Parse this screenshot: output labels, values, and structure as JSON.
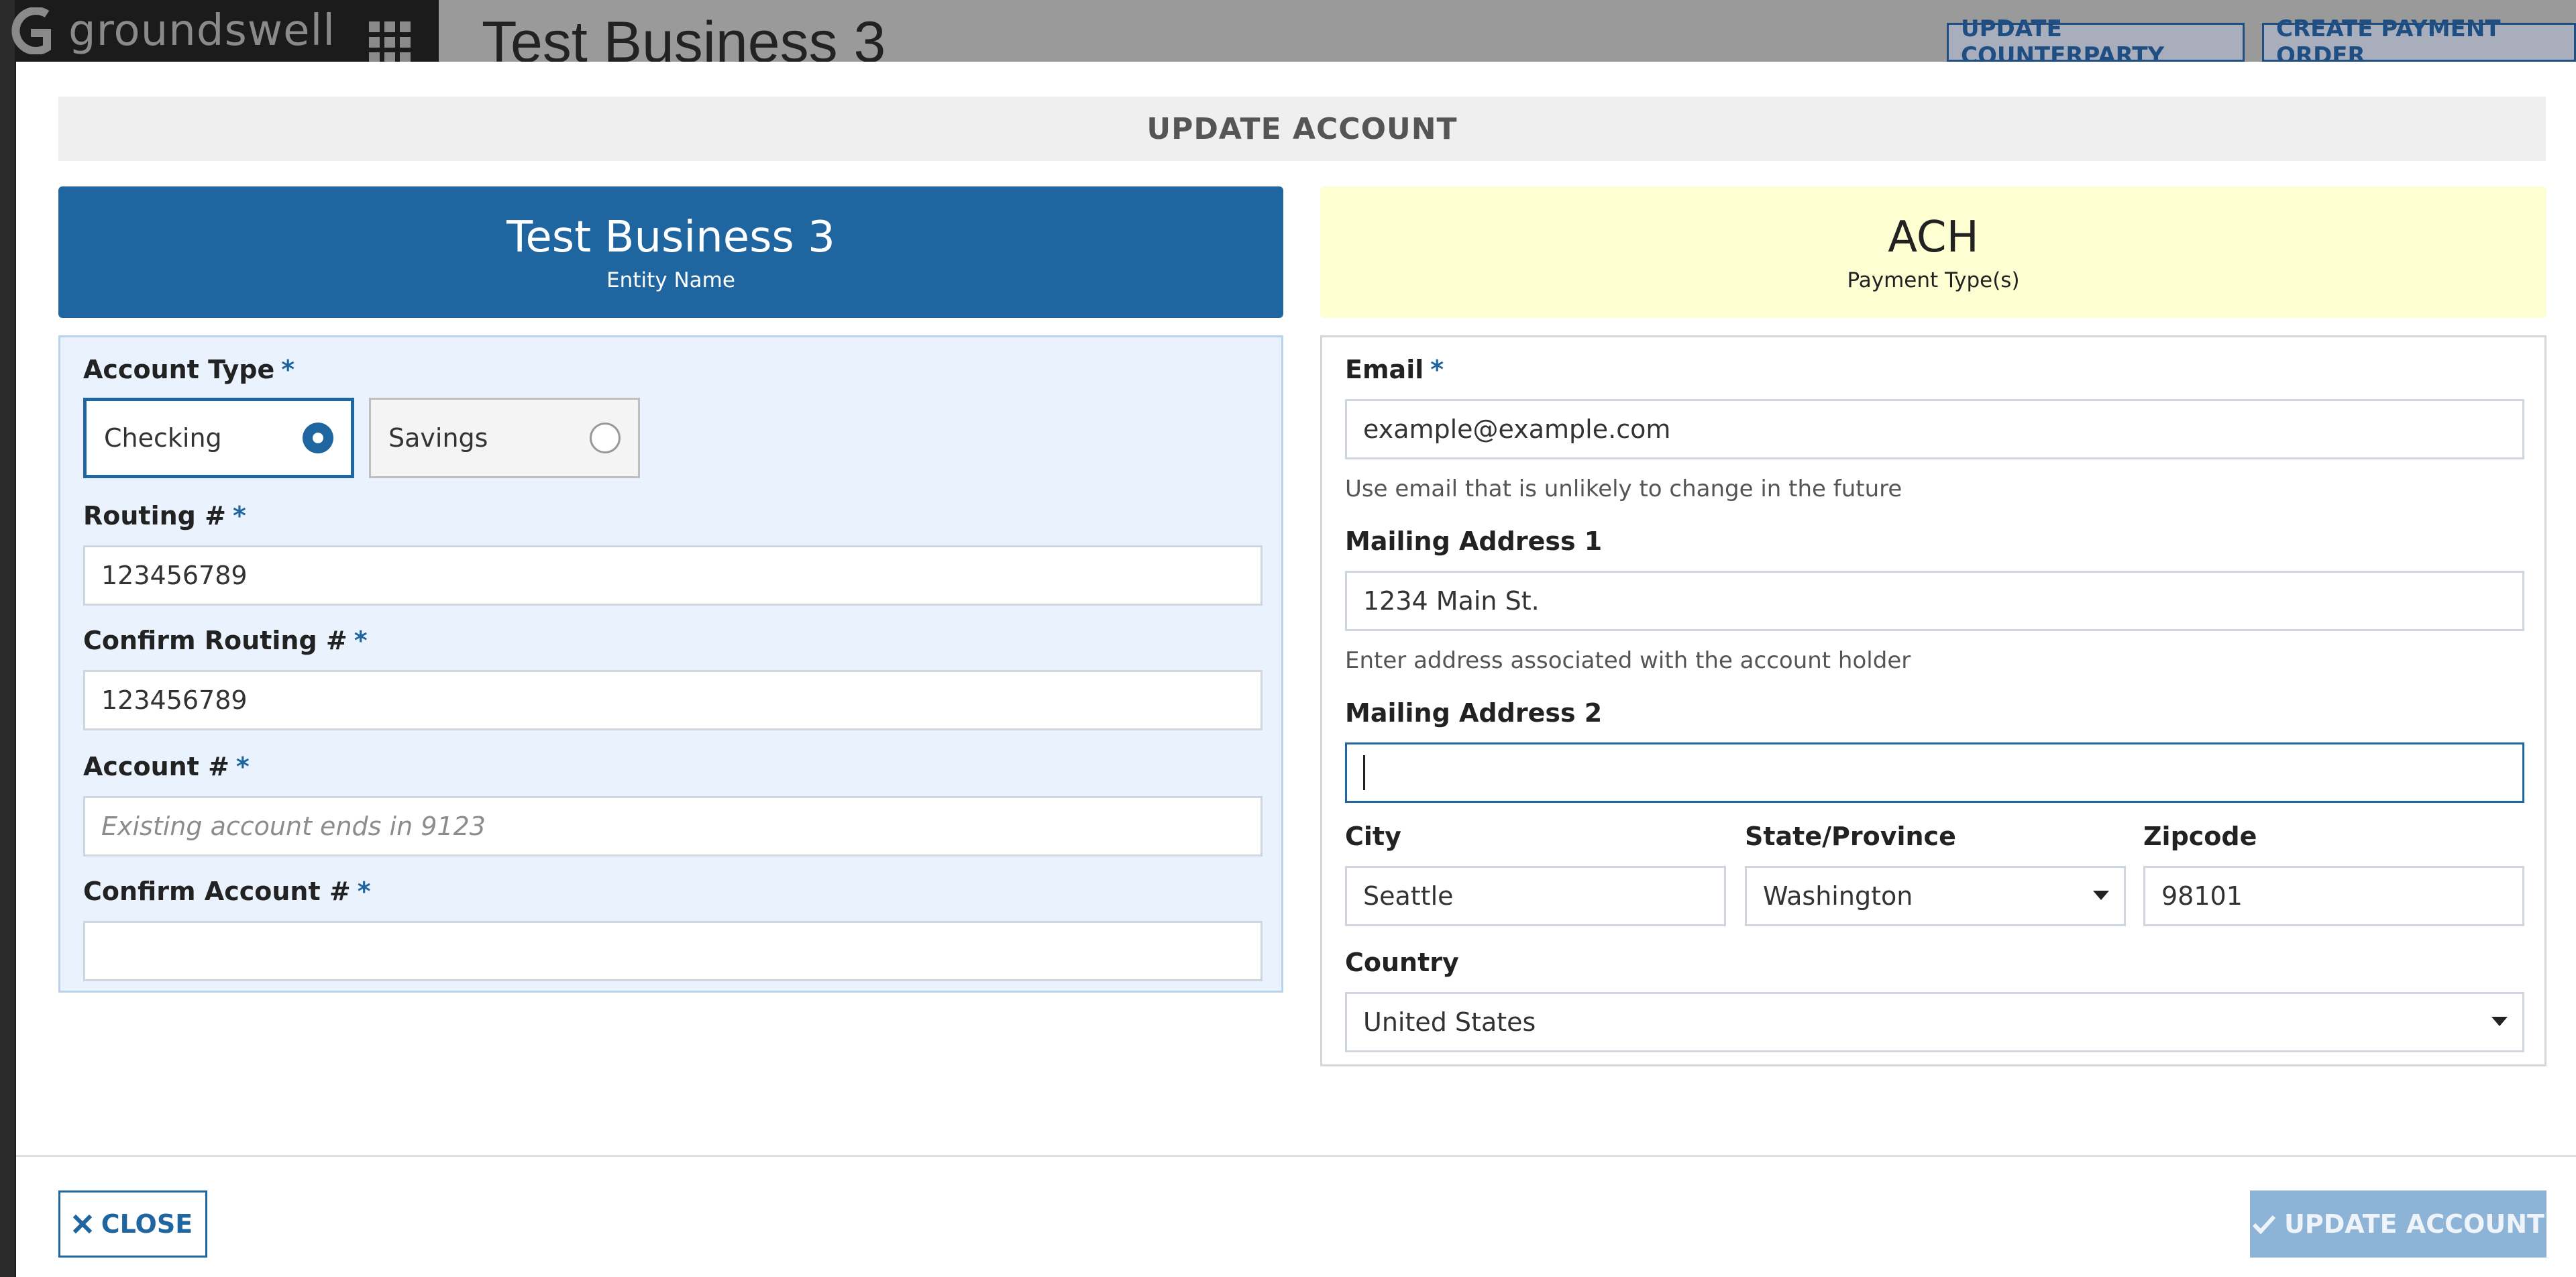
{
  "background": {
    "logo_text": "groundswell",
    "page_title": "Test Business 3",
    "buttons": [
      "UPDATE COUNTERPARTY",
      "CREATE PAYMENT ORDER"
    ]
  },
  "modal": {
    "title": "UPDATE ACCOUNT",
    "entity": {
      "name": "Test Business 3",
      "caption": "Entity Name"
    },
    "payment": {
      "type": "ACH",
      "caption": "Payment Type(s)"
    },
    "left": {
      "account_type_label": "Account Type",
      "account_type_options": [
        {
          "label": "Checking",
          "selected": true
        },
        {
          "label": "Savings",
          "selected": false
        }
      ],
      "routing_label": "Routing #",
      "routing_value": "123456789",
      "confirm_routing_label": "Confirm Routing #",
      "confirm_routing_value": "123456789",
      "account_label": "Account #",
      "account_placeholder": "Existing account ends in 9123",
      "confirm_account_label": "Confirm Account #",
      "confirm_account_value": ""
    },
    "right": {
      "email_label": "Email",
      "email_value": "example@example.com",
      "email_help": "Use email that is unlikely to change in the future",
      "address1_label": "Mailing Address 1",
      "address1_value": "1234 Main St.",
      "address1_help": "Enter address associated with the account holder",
      "address2_label": "Mailing Address 2",
      "address2_value": "",
      "city_label": "City",
      "city_value": "Seattle",
      "state_label": "State/Province",
      "state_value": "Washington",
      "zip_label": "Zipcode",
      "zip_value": "98101",
      "country_label": "Country",
      "country_value": "United States"
    },
    "required_marker": "*",
    "close_label": "CLOSE",
    "update_label": "UPDATE ACCOUNT"
  },
  "colors": {
    "primary": "#1f65a0",
    "payment_card": "#fefed3",
    "left_panel": "#eaf3fd",
    "disabled_button": "#8db3d6"
  }
}
